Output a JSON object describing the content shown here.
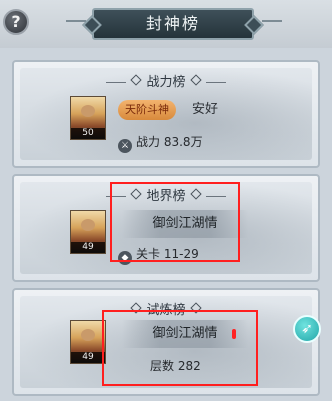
{
  "header": {
    "title": "封神榜",
    "help_icon": "?"
  },
  "cards": [
    {
      "title": "战力榜",
      "level": "50",
      "badge": "天阶斗神",
      "player": "安好",
      "stat_icon": "power-icon",
      "stat_label": "战力",
      "stat_value": "83.8万"
    },
    {
      "title": "地界榜",
      "level": "49",
      "player": "御剑江湖情",
      "stat_icon": "stage-icon",
      "stat_label": "关卡",
      "stat_value": "11-29"
    },
    {
      "title": "试炼榜",
      "level": "49",
      "player": "御剑江湖情",
      "stat_label": "层数",
      "stat_value": "282"
    }
  ],
  "colors": {
    "highlight": "#ff1f1f",
    "badge": "#d88a3c",
    "rocket": "#21a6a8"
  }
}
